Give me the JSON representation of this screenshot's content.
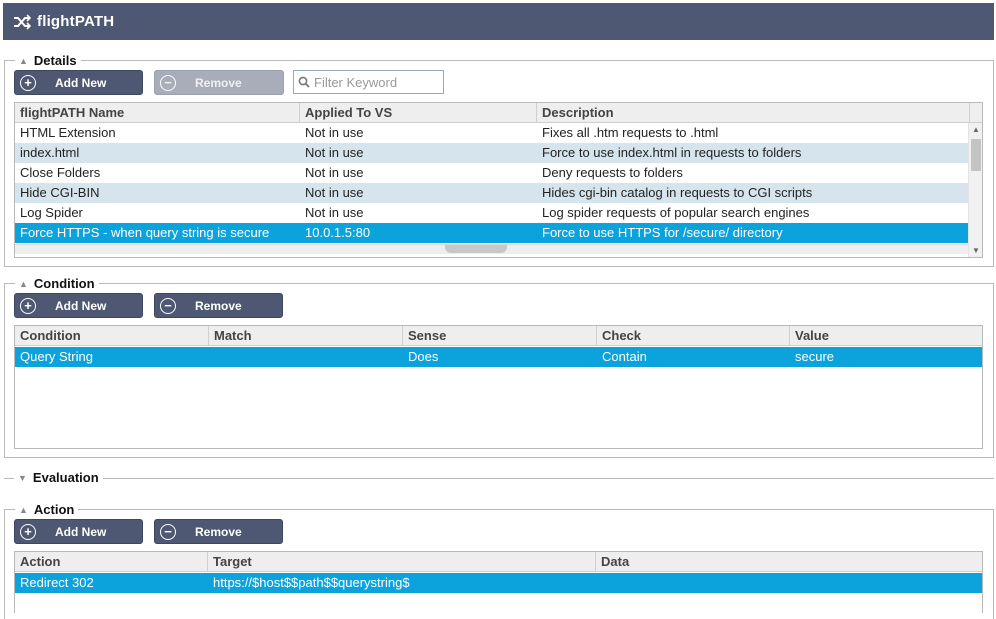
{
  "app": {
    "title": "flightPATH",
    "icon": "shuffle-icon"
  },
  "details": {
    "legend": "Details",
    "add_label": "Add New",
    "remove_label": "Remove",
    "filter_placeholder": "Filter Keyword",
    "columns": [
      "flightPATH Name",
      "Applied To VS",
      "Description"
    ],
    "rows": [
      {
        "name": "HTML Extension",
        "vs": "Not in use",
        "desc": "Fixes all .htm requests to .html"
      },
      {
        "name": "index.html",
        "vs": "Not in use",
        "desc": "Force to use index.html in requests to folders"
      },
      {
        "name": "Close Folders",
        "vs": "Not in use",
        "desc": "Deny requests to folders"
      },
      {
        "name": "Hide CGI-BIN",
        "vs": "Not in use",
        "desc": "Hides cgi-bin catalog in requests to CGI scripts"
      },
      {
        "name": "Log Spider",
        "vs": "Not in use",
        "desc": "Log spider requests of popular search engines"
      },
      {
        "name": "Force HTTPS - when query string is secure",
        "vs": "10.0.1.5:80",
        "desc": "Force to use HTTPS for /secure/ directory"
      }
    ],
    "selected_row": 5
  },
  "condition": {
    "legend": "Condition",
    "add_label": "Add New",
    "remove_label": "Remove",
    "columns": [
      "Condition",
      "Match",
      "Sense",
      "Check",
      "Value"
    ],
    "rows": [
      {
        "condition": "Query String",
        "match": "",
        "sense": "Does",
        "check": "Contain",
        "value": "secure"
      }
    ]
  },
  "evaluation": {
    "legend": "Evaluation"
  },
  "action": {
    "legend": "Action",
    "add_label": "Add New",
    "remove_label": "Remove",
    "columns": [
      "Action",
      "Target",
      "Data"
    ],
    "rows": [
      {
        "action": "Redirect 302",
        "target": "https://$host$$path$$querystring$",
        "data": ""
      }
    ]
  },
  "colors": {
    "titlebar": "#4e5873",
    "button": "#4e5873",
    "selected_row": "#0ca3dd",
    "alt_row": "#d6e5ed"
  }
}
